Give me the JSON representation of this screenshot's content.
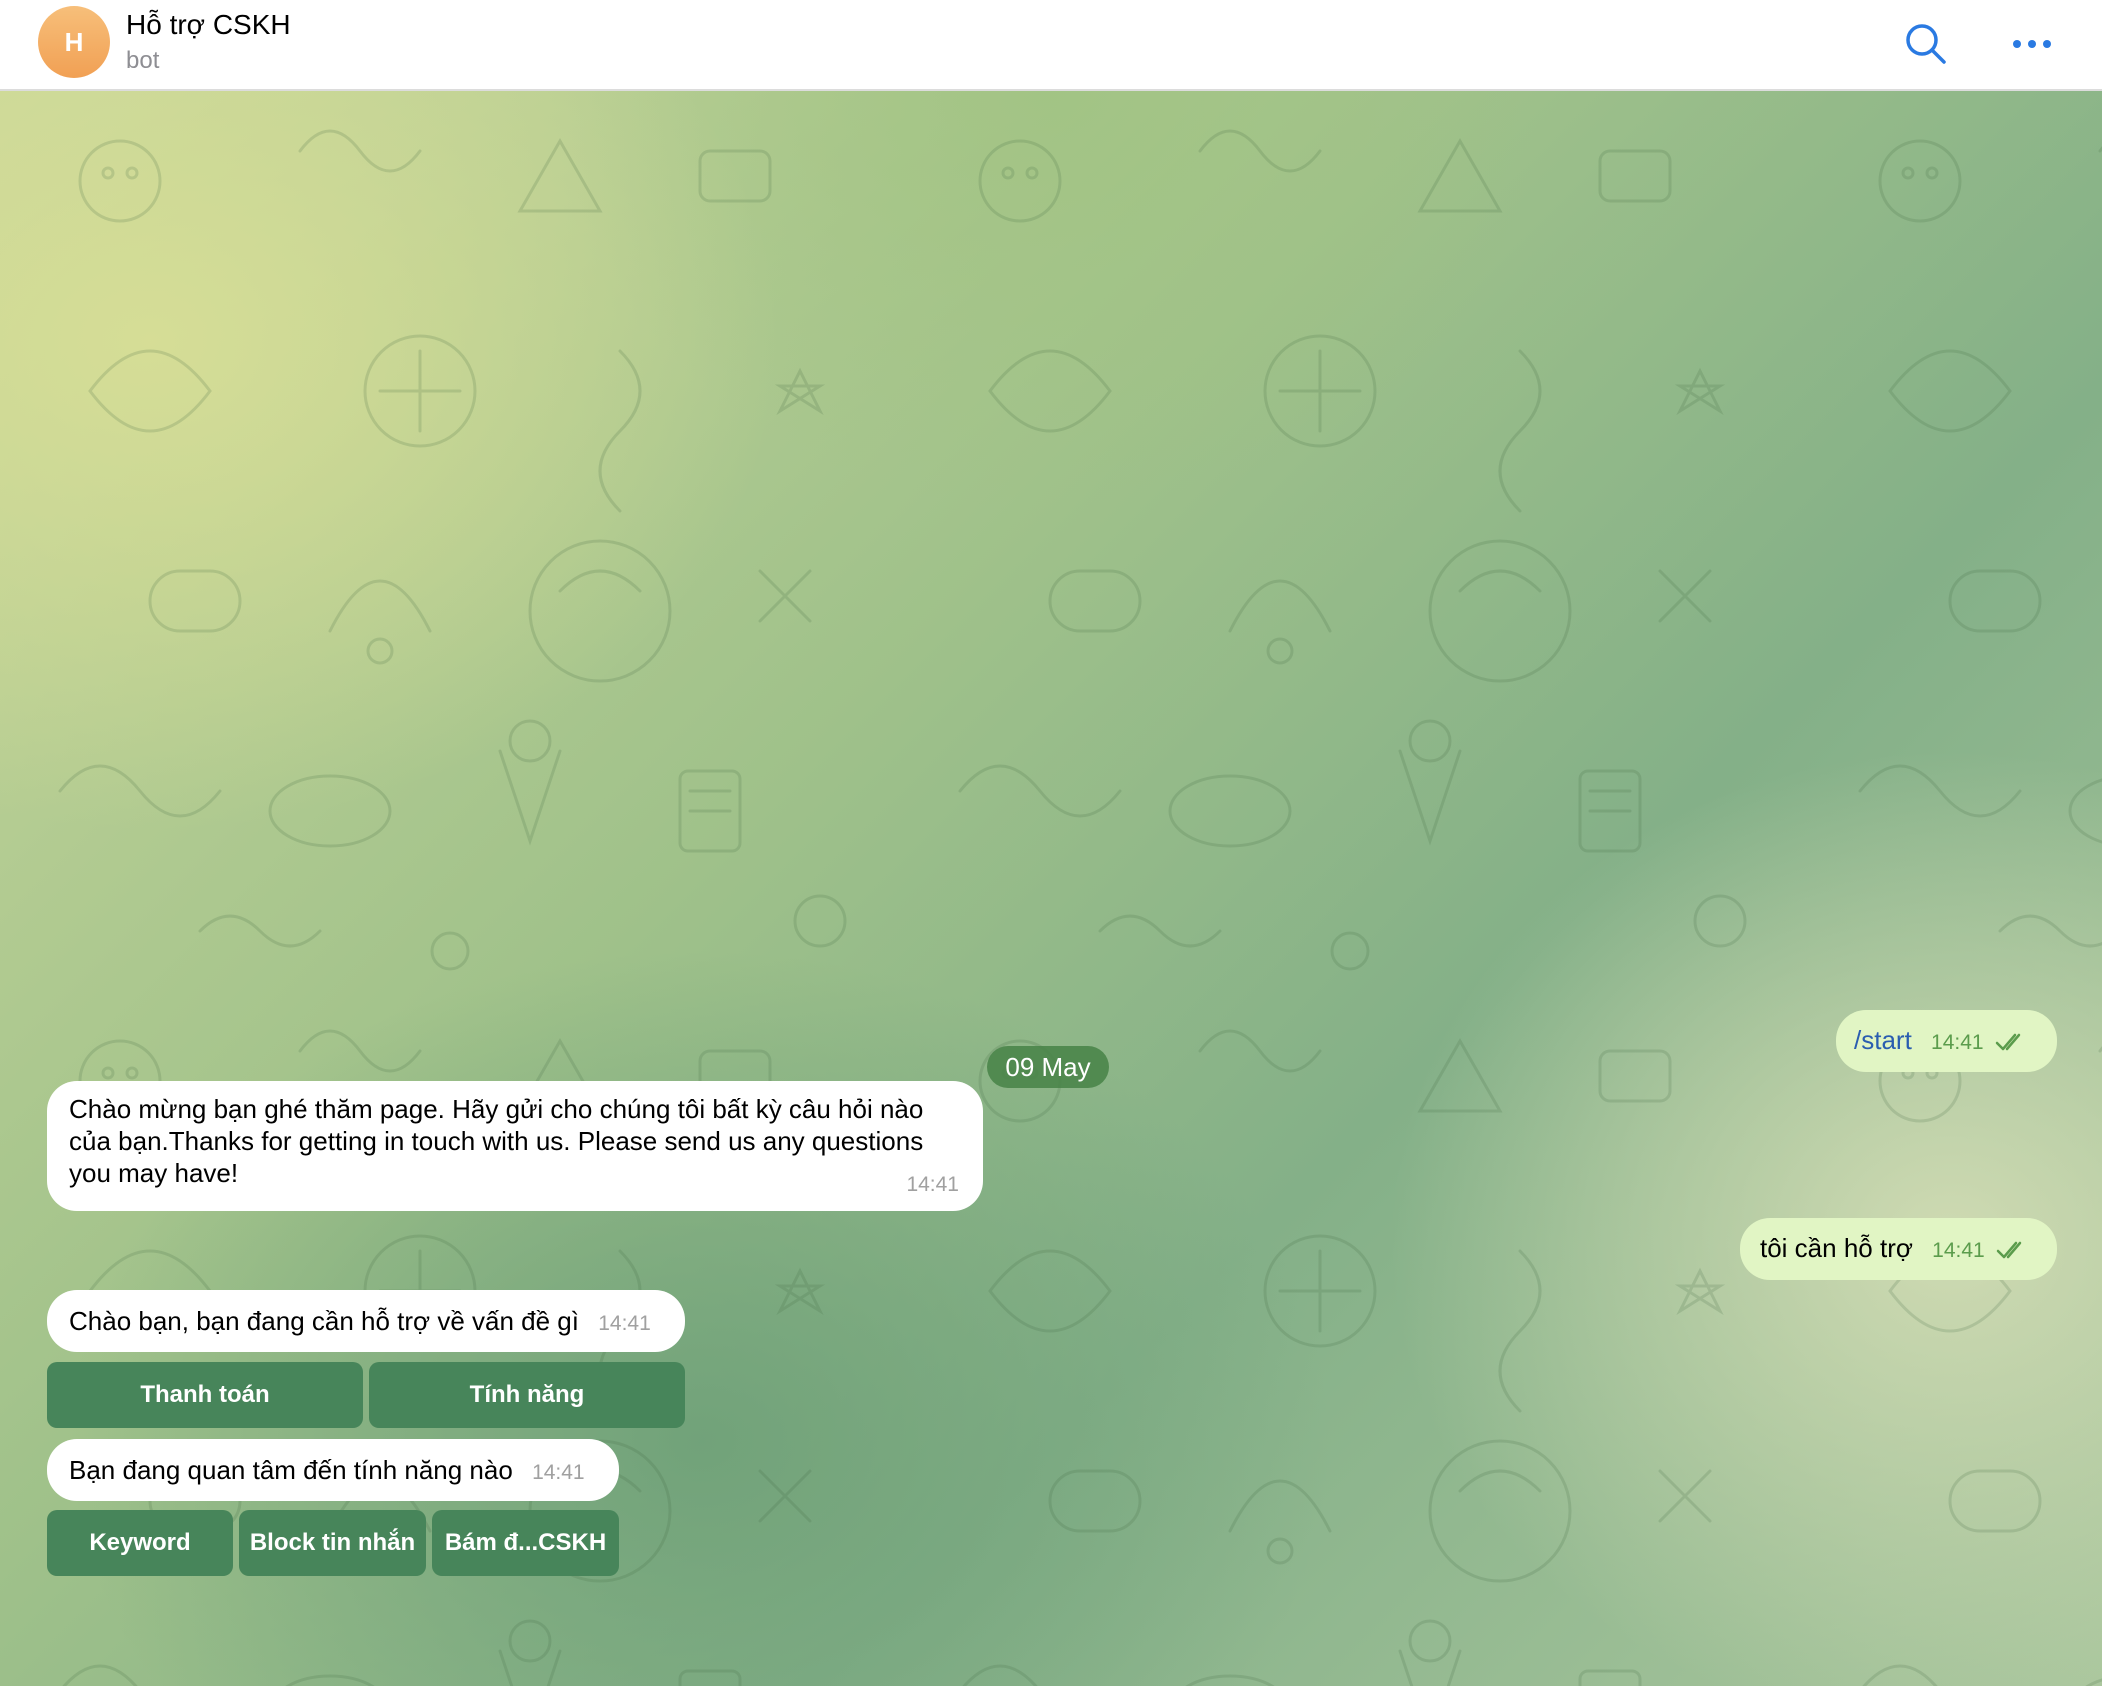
{
  "header": {
    "avatar_letter": "H",
    "title": "Hỗ trợ CSKH",
    "subtitle": "bot",
    "search_icon": "search-icon",
    "more_icon": "more-icon"
  },
  "chat": {
    "date": "09 May",
    "messages": {
      "start": {
        "command": "/start",
        "time": "14:41",
        "status": "read"
      },
      "welcome": {
        "text": "Chào mừng bạn ghé thăm page. Hãy gửi cho chúng tôi bất kỳ câu hỏi nào của bạn.Thanks for getting in touch with us. Please send us any questions you may have!",
        "time": "14:41"
      },
      "need_support": {
        "text": "tôi cần hỗ trợ",
        "time": "14:41",
        "status": "read"
      },
      "ask_issue": {
        "text": "Chào bạn, bạn đang cần hỗ trợ về vấn đề gì",
        "time": "14:41"
      },
      "ask_feature": {
        "text": "Bạn đang quan tâm đến tính năng nào",
        "time": "14:41"
      }
    },
    "keyboard1": {
      "payment": "Thanh toán",
      "features": "Tính năng"
    },
    "keyboard2": {
      "keyword": "Keyword",
      "block": "Block tin nhắn",
      "bam": "Bám đ...CSKH"
    }
  },
  "colors": {
    "accent": "#2a7ae2",
    "incoming_bubble": "#ffffff",
    "outgoing_bubble": "#e1f5c4",
    "keyboard_button": "#47855a",
    "date_pill": "#4c8a4c",
    "avatar": "#f1a054"
  }
}
